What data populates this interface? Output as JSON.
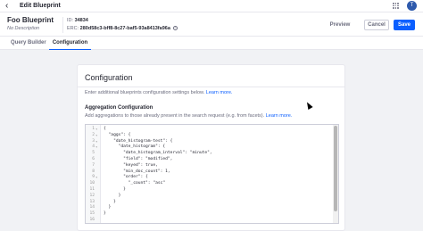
{
  "topbar": {
    "back_icon": "chevron-left-icon",
    "title": "Edit Blueprint",
    "apps_icon": "grid-icon",
    "avatar_initial": "T"
  },
  "header": {
    "name": "Foo Blueprint",
    "description": "No Description",
    "id_label": "ID:",
    "id_value": "34834",
    "erc_label": "ERC:",
    "erc_value": "280d58c3-bff8-8c27-baf5-93a8413fa96a",
    "copy_icon": "info-icon",
    "preview_label": "Preview",
    "cancel_label": "Cancel",
    "save_label": "Save"
  },
  "tabs": [
    {
      "label": "Query Builder"
    },
    {
      "label": "Configuration"
    }
  ],
  "config": {
    "title": "Configuration",
    "intro": "Enter additional blueprints configuration settings below.",
    "intro_link": "Learn more.",
    "agg_title": "Aggregation Configuration",
    "agg_desc": "Add aggregations to those already present in the search request (e.g. from facets).",
    "agg_link": "Learn more."
  },
  "editor": {
    "line_numbers": [
      "1",
      "2",
      "3",
      "4",
      "5",
      "6",
      "7",
      "8",
      "9",
      "10",
      "11",
      "12",
      "13",
      "14",
      "15",
      "16"
    ],
    "lines": [
      "{",
      "  \"aggs\": {",
      "    \"date_histogram-test\": {",
      "      \"date_histogram\": {",
      "        \"date_histogram_interval\": \"minute\",",
      "        \"field\": \"modified\",",
      "        \"keyed\": true,",
      "        \"min_doc_count\": 1,",
      "        \"order\": {",
      "          \"_count\": \"asc\"",
      "        }",
      "      }",
      "    }",
      "  }",
      "}",
      ""
    ]
  },
  "colors": {
    "accent": "#0b5fff",
    "text": "#272833",
    "muted": "#6b6c7e"
  }
}
